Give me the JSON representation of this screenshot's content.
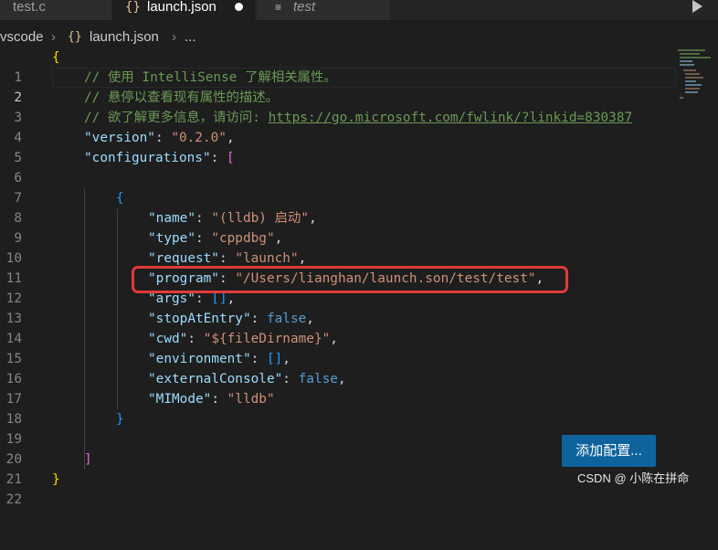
{
  "tabs": [
    {
      "label": "test.c",
      "icon": "c-file-icon"
    },
    {
      "label": "launch.json",
      "icon": "json-braces-icon",
      "modified": true
    },
    {
      "label": "test",
      "icon": "text-file-icon"
    }
  ],
  "breadcrumb": {
    "folder": "vscode",
    "file": "launch.json",
    "more": "..."
  },
  "icons": {
    "json": "{}",
    "text_file": "≡",
    "separator": "›"
  },
  "line_numbers": [
    "1",
    "2",
    "3",
    "4",
    "5",
    "6",
    "7",
    "8",
    "9",
    "10",
    "11",
    "12",
    "13",
    "14",
    "15",
    "16",
    "17",
    "18",
    "19",
    "20",
    "21",
    "22"
  ],
  "active_line": "2",
  "code": {
    "l1_brace": "{",
    "l2_comment": "// 使用 IntelliSense 了解相关属性。",
    "l3_comment": "// 悬停以查看现有属性的描述。",
    "l4_comment": "// 欲了解更多信息，请访问: ",
    "l4_link": "https://go.microsoft.com/fwlink/?linkid=830387",
    "l5_key": "\"version\"",
    "l5_value": "\"0.2.0\"",
    "l6_key": "\"configurations\"",
    "l6_bracket": "[",
    "l8_brace": "{",
    "l9_key": "\"name\"",
    "l9_value": "\"(lldb) 启动\"",
    "l10_key": "\"type\"",
    "l10_value": "\"cppdbg\"",
    "l11_key": "\"request\"",
    "l11_value": "\"launch\"",
    "l12_key": "\"program\"",
    "l12_value": "\"/Users/lianghan/launch.son/test/test\"",
    "l13_key": "\"args\"",
    "l13_value": "[]",
    "l14_key": "\"stopAtEntry\"",
    "l14_value": "false",
    "l15_key": "\"cwd\"",
    "l15_value": "\"${fileDirname}\"",
    "l16_key": "\"environment\"",
    "l16_value": "[]",
    "l17_key": "\"externalConsole\"",
    "l17_value": "false",
    "l18_key": "\"MIMode\"",
    "l18_value": "\"lldb\"",
    "l19_brace": "}",
    "l21_bracket": "]",
    "l22_brace": "}"
  },
  "add_config_button": "添加配置...",
  "watermark": "CSDN @ 小陈在拼命",
  "colors": {
    "editor_bg": "#1e1e1e",
    "comment": "#6a9955",
    "key": "#9cdcfe",
    "string": "#ce9178",
    "keyword": "#569cd6",
    "number": "#b5cea8",
    "button_bg": "#0e639c",
    "highlight_box": "#e03a3a"
  }
}
